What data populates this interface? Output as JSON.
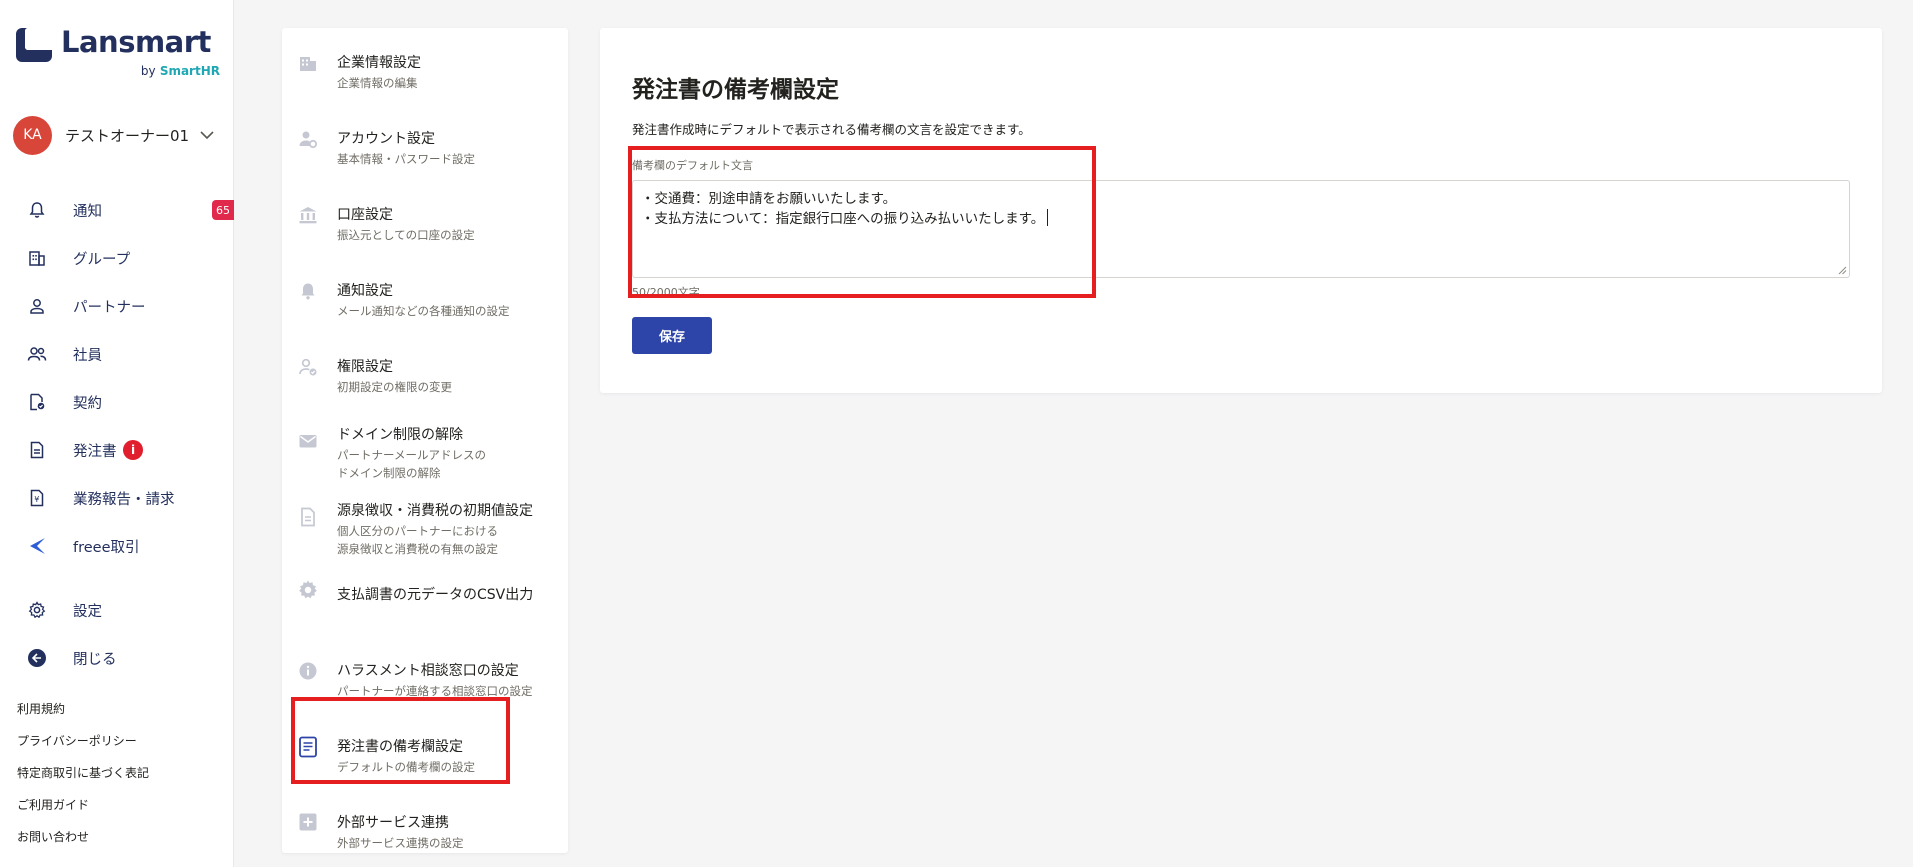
{
  "brand": {
    "name": "Lansmart",
    "by": "by",
    "vendor": "SmartHR",
    "brand_color": "#23305e",
    "accent_color": "#1fa7b4"
  },
  "user": {
    "initials": "KA",
    "name": "テストオーナー01",
    "avatar_color": "#d8463a"
  },
  "nav": {
    "items": [
      {
        "label": "通知",
        "icon": "bell-icon",
        "badge": "65"
      },
      {
        "label": "グループ",
        "icon": "building-icon"
      },
      {
        "label": "パートナー",
        "icon": "person-icon"
      },
      {
        "label": "社員",
        "icon": "people-icon"
      },
      {
        "label": "契約",
        "icon": "contract-icon"
      },
      {
        "label": "発注書",
        "icon": "document-icon",
        "alert": "i"
      },
      {
        "label": "業務報告・請求",
        "icon": "invoice-icon"
      },
      {
        "label": "freee取引",
        "icon": "freee-icon"
      },
      {
        "label": "設定",
        "icon": "gear-icon"
      },
      {
        "label": "閉じる",
        "icon": "collapse-icon"
      }
    ]
  },
  "footer": {
    "links": [
      "利用規約",
      "プライバシーポリシー",
      "特定商取引に基づく表記",
      "ご利用ガイド",
      "お問い合わせ"
    ]
  },
  "settings_menu": {
    "items": [
      {
        "title": "企業情報設定",
        "sub": [
          "企業情報の編集"
        ],
        "icon": "building-icon"
      },
      {
        "title": "アカウント設定",
        "sub": [
          "基本情報・パスワード設定"
        ],
        "icon": "account-gear-icon"
      },
      {
        "title": "口座設定",
        "sub": [
          "振込元としての口座の設定"
        ],
        "icon": "bank-icon"
      },
      {
        "title": "通知設定",
        "sub": [
          "メール通知などの各種通知の設定"
        ],
        "icon": "bell-icon"
      },
      {
        "title": "権限設定",
        "sub": [
          "初期設定の権限の変更"
        ],
        "icon": "user-check-icon"
      },
      {
        "title": "ドメイン制限の解除",
        "sub": [
          "パートナーメールアドレスの",
          "ドメイン制限の解除"
        ],
        "icon": "mail-icon"
      },
      {
        "title": "源泉徴収・消費税の初期値設定",
        "sub": [
          "個人区分のパートナーにおける",
          "源泉徴収と消費税の有無の設定"
        ],
        "icon": "document-icon"
      },
      {
        "title": "支払調書の元データのCSV出力",
        "sub": [],
        "icon": "gear-icon"
      },
      {
        "title": "ハラスメント相談窓口の設定",
        "sub": [
          "パートナーが連絡する相談窓口の設定"
        ],
        "icon": "info-icon"
      },
      {
        "title": "発注書の備考欄設定",
        "sub": [
          "デフォルトの備考欄の設定"
        ],
        "icon": "note-icon",
        "active": true
      },
      {
        "title": "外部サービス連携",
        "sub": [
          "外部サービス連携の設定"
        ],
        "icon": "plus-box-icon"
      }
    ]
  },
  "main": {
    "title": "発注書の備考欄設定",
    "description": "発注書作成時にデフォルトで表示される備考欄の文言を設定できます。",
    "field_label": "備考欄のデフォルト文言",
    "textarea_value": "・交通費：別途申請をお願いいたします。\n・支払方法について：指定銀行口座への振り込み払いいたします。",
    "char_count": "50/2000文字",
    "save_label": "保存",
    "primary_color": "#2d44a8"
  },
  "annotations": {
    "highlight_color": "#e51f1f"
  }
}
